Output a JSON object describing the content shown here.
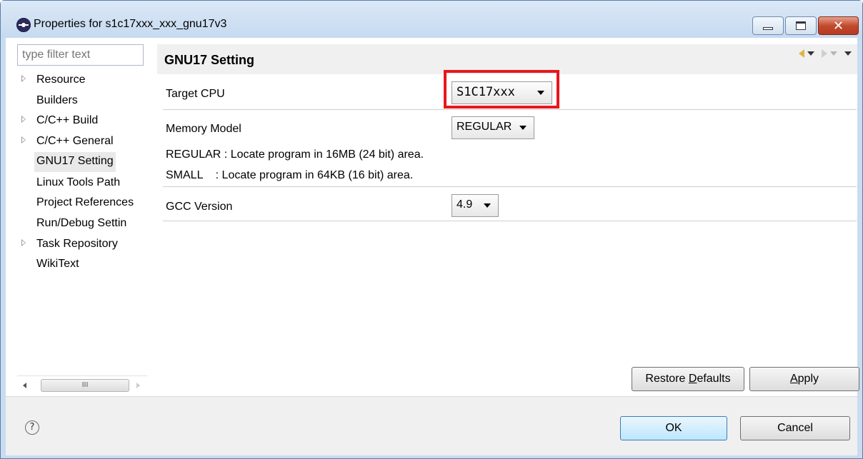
{
  "window": {
    "title": "Properties for s1c17xxx_xxx_gnu17v3",
    "close_glyph": "✕"
  },
  "filter": {
    "placeholder": "type filter text"
  },
  "tree": {
    "items": [
      {
        "label": "Resource",
        "expandable": true
      },
      {
        "label": "Builders",
        "expandable": false
      },
      {
        "label": "C/C++ Build",
        "expandable": true
      },
      {
        "label": "C/C++ General",
        "expandable": true
      },
      {
        "label": "GNU17 Setting",
        "expandable": false,
        "selected": true
      },
      {
        "label": "Linux Tools Path",
        "expandable": false
      },
      {
        "label": "Project References",
        "expandable": false
      },
      {
        "label": "Run/Debug Settin",
        "expandable": false
      },
      {
        "label": "Task Repository",
        "expandable": true
      },
      {
        "label": "WikiText",
        "expandable": false
      }
    ],
    "scroll_thumb_glyph": "III"
  },
  "page": {
    "title": "GNU17 Setting"
  },
  "settings": {
    "target_cpu": {
      "label": "Target CPU",
      "value": "S1C17xxx"
    },
    "memory_model": {
      "label": "Memory Model",
      "value": "REGULAR",
      "desc_regular": "REGULAR : Locate program in 16MB (24 bit) area.",
      "desc_small": "SMALL    : Locate program in 64KB (16 bit) area."
    },
    "gcc_version": {
      "label": "GCC Version",
      "value": "4.9"
    }
  },
  "buttons": {
    "restore_defaults_pre": "Restore ",
    "restore_defaults_mn": "D",
    "restore_defaults_post": "efaults",
    "apply_mn": "A",
    "apply_post": "pply",
    "ok": "OK",
    "cancel": "Cancel",
    "help": "?"
  },
  "colors": {
    "highlight": "#e8161d",
    "back_arrow": "#e0b44a"
  }
}
